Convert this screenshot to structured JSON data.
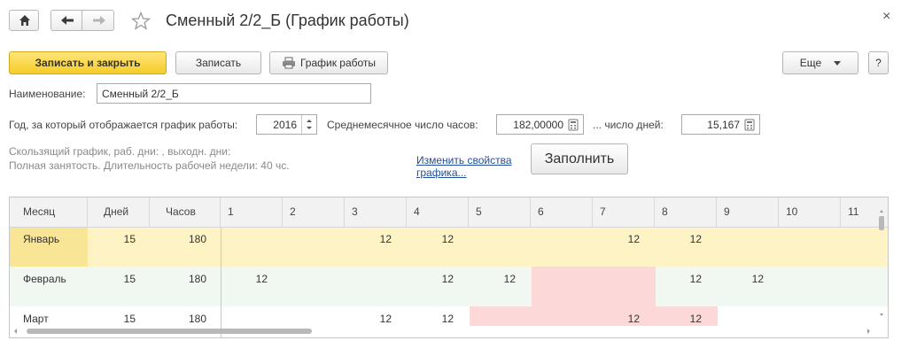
{
  "window": {
    "title": "Сменный 2/2_Б (График работы)",
    "close_symbol": "×"
  },
  "toolbar": {
    "save_close_label": "Записать и закрыть",
    "save_label": "Записать",
    "schedule_label": "График работы",
    "more_label": "Еще",
    "help_label": "?"
  },
  "form": {
    "name_label": "Наименование:",
    "name_value": "Сменный 2/2_Б",
    "year_label": "Год, за который отображается график работы:",
    "year_value": "2016",
    "avg_hours_label": "Среднемесячное число часов:",
    "avg_hours_value": "182,00000",
    "days_label": "... число дней:",
    "days_value": "15,167",
    "info_line1": "Скользящий график, раб. дни: , выходн. дни:",
    "info_line2": "Полная занятость. Длительность рабочей недели: 40 чс.",
    "change_link": "Изменить свойства графика...",
    "fill_label": "Заполнить"
  },
  "table": {
    "headers": [
      "Месяц",
      "Дней",
      "Часов",
      "1",
      "2",
      "3",
      "4",
      "5",
      "6",
      "7",
      "8",
      "9",
      "10",
      "11"
    ],
    "rows": [
      {
        "month": "Январь",
        "days": "15",
        "hours": "180",
        "cells": [
          "",
          "",
          "12",
          "12",
          "",
          "",
          "12",
          "12",
          "",
          ""
        ]
      },
      {
        "month": "Февраль",
        "days": "15",
        "hours": "180",
        "cells": [
          "12",
          "",
          "",
          "12",
          "12",
          "",
          "",
          "12",
          "12",
          ""
        ]
      },
      {
        "month": "Март",
        "days": "15",
        "hours": "180",
        "cells": [
          "",
          "",
          "12",
          "12",
          "",
          "",
          "12",
          "12",
          "",
          ""
        ]
      }
    ]
  },
  "colors": {
    "selected_row": "#fdf3c4",
    "selected_month": "#f9e596",
    "row_alt": "#f1f8f2",
    "holiday": "#fcd8d8"
  }
}
